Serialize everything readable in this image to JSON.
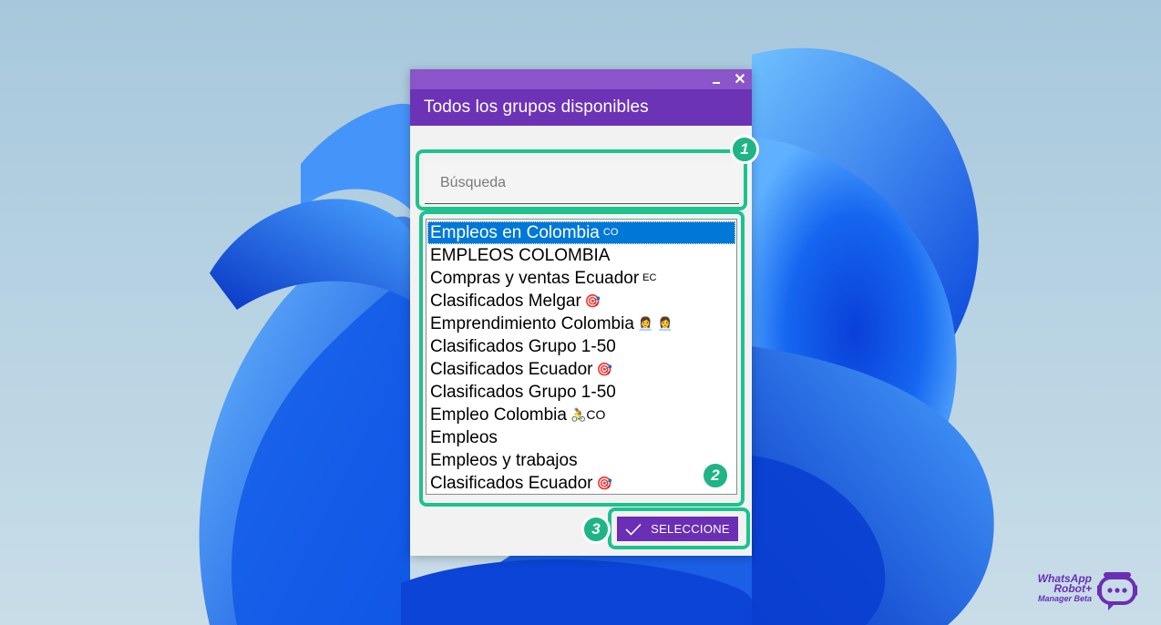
{
  "dialog": {
    "title": "Todos los grupos disponibles",
    "minimize_label": "_",
    "close_label": "✕"
  },
  "search": {
    "placeholder": "Búsqueda",
    "value": ""
  },
  "groups": [
    {
      "name": "Empleos en Colombia",
      "suffix": "CO",
      "selected": true
    },
    {
      "name": "EMPLEOS COLOMBIA",
      "suffix": ""
    },
    {
      "name": "Compras y ventas Ecuador",
      "suffix": "EC"
    },
    {
      "name": "Clasificados Melgar",
      "suffix": "🎯"
    },
    {
      "name": "Emprendimiento Colombia",
      "suffix": "👩‍💼 👩‍💼"
    },
    {
      "name": "Clasificados Grupo 1-50",
      "suffix": ""
    },
    {
      "name": "Clasificados Ecuador",
      "suffix": "🎯"
    },
    {
      "name": "Clasificados Grupo 1-50",
      "suffix": ""
    },
    {
      "name": "Empleo Colombia",
      "suffix": "🚴CO"
    },
    {
      "name": "Empleos",
      "suffix": ""
    },
    {
      "name": "Empleos y trabajos",
      "suffix": ""
    },
    {
      "name": "Clasificados Ecuador",
      "suffix": "🎯"
    }
  ],
  "select_button": {
    "label": "SELECCIONE"
  },
  "callouts": {
    "one": "1",
    "two": "2",
    "three": "3"
  },
  "brand": {
    "line1": "WhatsApp",
    "line2": "Robot+",
    "line3": "Manager Beta"
  },
  "colors": {
    "title_strip": "#8a55c9",
    "header": "#6c33b7",
    "button": "#6a2fb5",
    "selection": "#0078d7",
    "callout": "#1ec28f"
  },
  "icons": {
    "minimize": "minimize-icon",
    "close": "close-icon",
    "select": "check-icon",
    "brand": "robot-chat-icon"
  }
}
